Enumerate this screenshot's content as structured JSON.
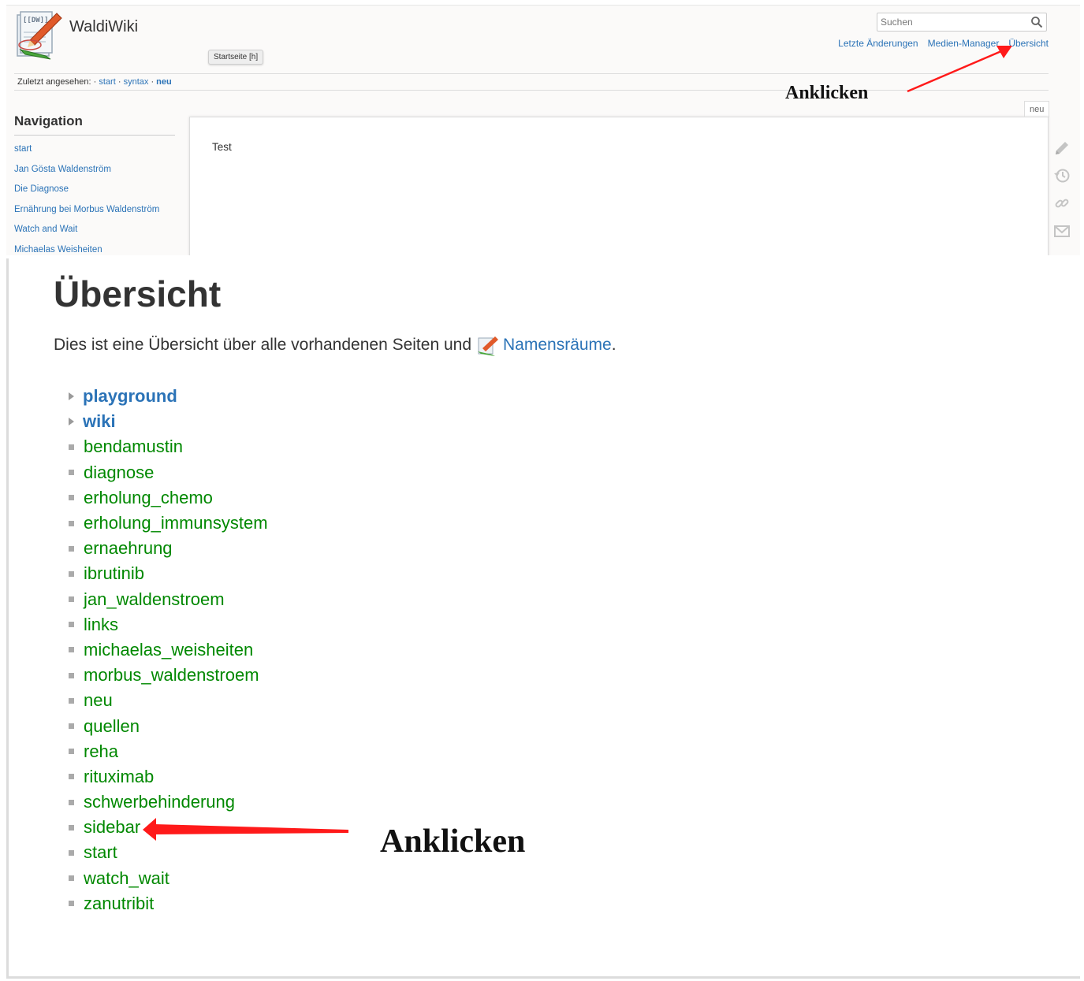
{
  "wiki": {
    "site_title": "WaldiWiki",
    "search_placeholder": "Suchen",
    "user_tools": [
      "Letzte Änderungen",
      "Medien-Manager",
      "Übersicht"
    ],
    "tooltip": "Startseite [h]",
    "breadcrumbs": {
      "label": "Zuletzt angesehen:",
      "sep": "·",
      "items": [
        "start",
        "syntax",
        "neu"
      ]
    },
    "navigation": {
      "title": "Navigation",
      "items": [
        "start",
        "Jan Gösta Waldenström",
        "Die Diagnose",
        "Ernährung bei Morbus Waldenström",
        "Watch and Wait",
        "Michaelas Weisheiten"
      ]
    },
    "page_tab": "neu",
    "content_text": "Test",
    "page_tool_icons": [
      "pencil-icon",
      "history-icon",
      "link-icon",
      "mail-icon"
    ]
  },
  "index_page": {
    "title": "Übersicht",
    "intro_before": "Dies ist eine Übersicht über alle vorhandenen Seiten und",
    "intro_link": "Namensräume",
    "intro_after": ".",
    "namespaces": [
      "playground",
      "wiki"
    ],
    "pages": [
      "bendamustin",
      "diagnose",
      "erholung_chemo",
      "erholung_immunsystem",
      "ernaehrung",
      "ibrutinib",
      "jan_waldenstroem",
      "links",
      "michaelas_weisheiten",
      "morbus_waldenstroem",
      "neu",
      "quellen",
      "reha",
      "rituximab",
      "schwerbehinderung",
      "sidebar",
      "start",
      "watch_wait",
      "zanutribit"
    ]
  },
  "annotations": {
    "top_label": "Anklicken",
    "bottom_label": "Anklicken"
  },
  "colors": {
    "link_blue": "#2b73b7",
    "page_green": "#008800",
    "arrow_red": "#ff1a1a"
  }
}
